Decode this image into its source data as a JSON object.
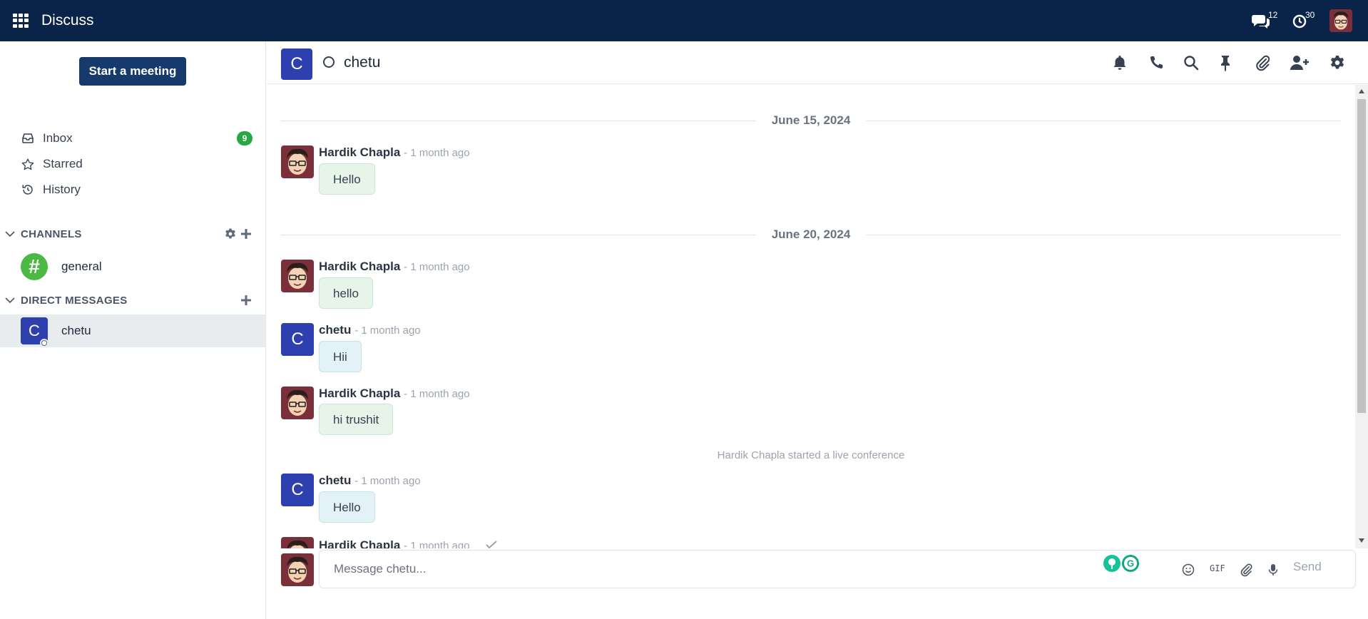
{
  "navbar": {
    "app_title": "Discuss",
    "messages_count": "12",
    "activities_count": "30",
    "bg_color": "#0a2449"
  },
  "sidebar": {
    "start_meeting_label": "Start a meeting",
    "items": [
      {
        "label": "Inbox",
        "icon": "inbox-icon",
        "badge": "9"
      },
      {
        "label": "Starred",
        "icon": "star-icon"
      },
      {
        "label": "History",
        "icon": "history-icon"
      }
    ],
    "channels_header": "CHANNELS",
    "channels": [
      {
        "name": "general",
        "avatar_symbol": "#"
      }
    ],
    "dm_header": "DIRECT MESSAGES",
    "direct_messages": [
      {
        "name": "chetu",
        "initial": "C",
        "active": true
      }
    ]
  },
  "thread": {
    "name": "chetu",
    "initial": "C",
    "header_icons": [
      "bell-icon",
      "phone-icon",
      "search-icon",
      "pin-icon",
      "paperclip-icon",
      "add-user-icon",
      "gear-icon"
    ],
    "date_1": "June 15, 2024",
    "date_2": "June 20, 2024",
    "messages": [
      {
        "author": "Hardik Chapla",
        "time": "- 1 month ago",
        "body": "Hello"
      },
      {
        "author": "Hardik Chapla",
        "time": "- 1 month ago",
        "body": "hello"
      },
      {
        "author": "chetu",
        "time": "- 1 month ago",
        "body": "Hii"
      },
      {
        "author": "Hardik Chapla",
        "time": "- 1 month ago",
        "body": "hi trushit"
      },
      {
        "author": "chetu",
        "time": "- 1 month ago",
        "body": "Hello"
      },
      {
        "author": "Hardik Chapla",
        "time": "- 1 month ago",
        "body": ""
      }
    ],
    "notification": "Hardik Chapla started a live conference"
  },
  "composer": {
    "placeholder": "Message chetu...",
    "gif_label": "GIF",
    "send_label": "Send"
  },
  "colors": {
    "primary": "#163a6b",
    "badge_green": "#28a745",
    "avatar_blue": "#2e3fb0",
    "channel_green": "#4cb944"
  }
}
